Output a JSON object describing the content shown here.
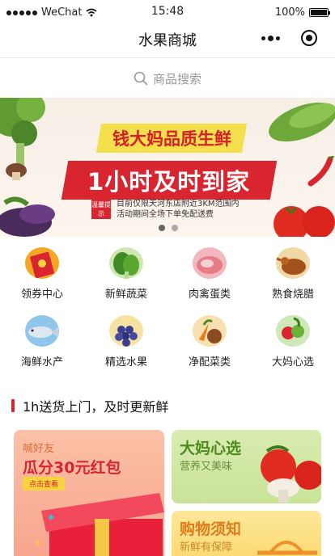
{
  "status_bar": {
    "carrier": "WeChat",
    "time": "15:48",
    "battery": "100%"
  },
  "nav": {
    "title": "水果商城",
    "more_icon": "more-dots-icon",
    "close_icon": "target-close-icon"
  },
  "search": {
    "placeholder": "商品搜索",
    "icon": "search-icon"
  },
  "banner": {
    "headline": "钱大妈品质生鲜",
    "main": "1小时及时到家",
    "tip_badge": "温馨提示",
    "note_line1": "目前仅限天河东店附近3KM范围内",
    "note_line2": "活动期间全场下单免配送费",
    "slide_count": 2,
    "active_slide": 1
  },
  "categories": [
    {
      "label": "领券中心",
      "icon": "red-packet-icon"
    },
    {
      "label": "新鲜蔬菜",
      "icon": "vegetable-icon"
    },
    {
      "label": "肉禽蛋类",
      "icon": "meat-icon"
    },
    {
      "label": "熟食烧腊",
      "icon": "roast-duck-icon"
    },
    {
      "label": "海鲜水产",
      "icon": "fish-icon"
    },
    {
      "label": "精选水果",
      "icon": "grapes-icon"
    },
    {
      "label": "净配菜类",
      "icon": "prepared-vegetables-icon"
    },
    {
      "label": "大妈心选",
      "icon": "fruit-basket-icon"
    }
  ],
  "section": {
    "title": "1h送货上门，及时更新鲜"
  },
  "promos": {
    "left": {
      "sub": "喊好友",
      "title": "瓜分30元红包",
      "button": "点击查看"
    },
    "right_top": {
      "title": "大妈心选",
      "sub": "营养又美味"
    },
    "right_bottom": {
      "title": "购物须知",
      "sub": "新鲜有保障"
    }
  },
  "colors": {
    "accent_red": "#d9252f",
    "banner_yellow": "#f4e04d",
    "green_title": "#4f8a1e",
    "orange_title": "#e07b1a"
  }
}
